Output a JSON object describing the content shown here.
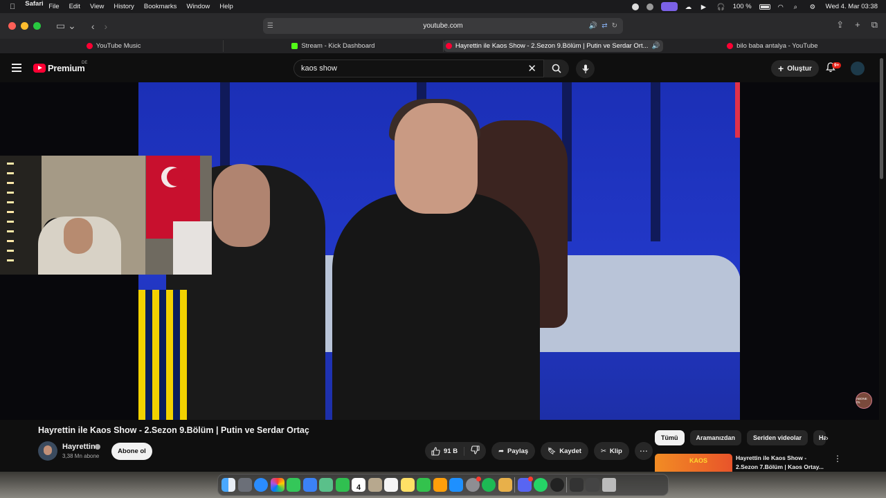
{
  "menubar": {
    "apple": "",
    "app_name": "Safari",
    "menus": [
      "File",
      "Edit",
      "View",
      "History",
      "Bookmarks",
      "Window",
      "Help"
    ],
    "battery": "100 %",
    "datetime": "Wed 4. Mar  03:38"
  },
  "browser": {
    "url": "youtube.com",
    "tabs": [
      {
        "label": "YouTube Music",
        "icon": "youtube-music-icon",
        "active": false
      },
      {
        "label": "Stream - Kick Dashboard",
        "icon": "kick-icon",
        "active": false
      },
      {
        "label": "Hayrettin ile Kaos Show - 2.Sezon 9.Bölüm | Putin ve Serdar Ort...",
        "icon": "youtube-icon",
        "active": true
      },
      {
        "label": "bilo baba antalya - YouTube",
        "icon": "youtube-icon",
        "active": false
      }
    ]
  },
  "youtube": {
    "logo_text": "Premium",
    "logo_region": "DE",
    "search_value": "kaos show",
    "create_label": "Oluştur",
    "notification_count": "9+",
    "accent": "#ff0033"
  },
  "video": {
    "title": "Hayrettin ile Kaos Show - 2.Sezon 9.Bölüm | Putin ve Serdar Ortaç",
    "channel": "Hayrettin",
    "subscribers": "3,38 Mn abone",
    "subscribe_label": "Abone ol",
    "likes": "91 B",
    "share_label": "Paylaş",
    "save_label": "Kaydet",
    "clip_label": "Klip",
    "watermark": "ABONE OL"
  },
  "sidebar": {
    "chips": [
      "Tümü",
      "Aramanızdan",
      "Seriden videolar",
      "Hayrettin"
    ],
    "recommendation": {
      "thumb_text": "KAOS",
      "title": "Hayrettin ile Kaos Show - 2.Sezon 7.Bölüm | Kaos Ortay..."
    }
  },
  "dock": {
    "calendar_day": "4"
  }
}
